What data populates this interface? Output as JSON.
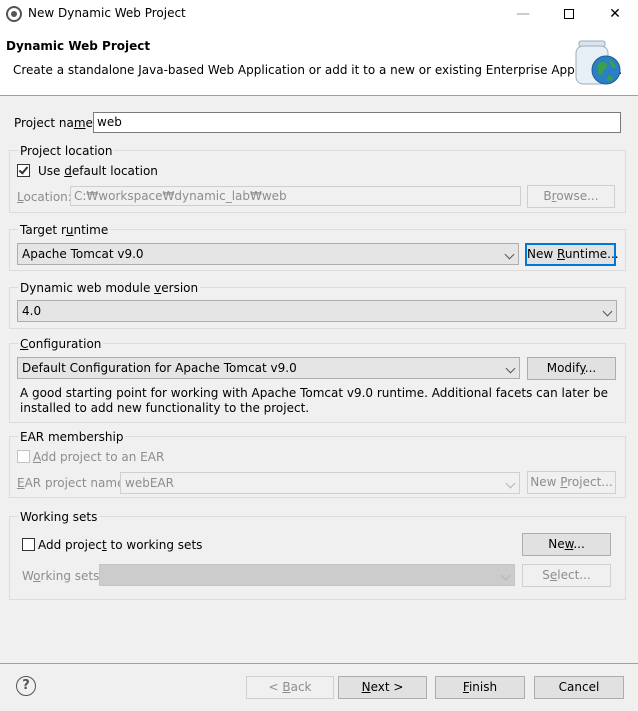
{
  "window": {
    "title": "New Dynamic Web Project",
    "minimize_glyph": "—",
    "close_glyph": "✕"
  },
  "banner": {
    "title": "Dynamic Web Project",
    "description": "Create a standalone Java-based Web Application or add it to a new or existing Enterprise Application."
  },
  "project_name": {
    "label_pre": "Project na",
    "label_u": "m",
    "label_post": "e:",
    "value": "web"
  },
  "project_location": {
    "group_label": "Project location",
    "use_default_pre": "Use ",
    "use_default_u": "d",
    "use_default_post": "efault location",
    "use_default_checked": true,
    "location_label_u": "L",
    "location_label_post": "ocation:",
    "location_value": "C:₩workspace₩dynamic_lab₩web",
    "browse_label_pre": "B",
    "browse_label_u": "r",
    "browse_label_post": "owse..."
  },
  "target_runtime": {
    "label_pre": "Target r",
    "label_u": "u",
    "label_post": "ntime",
    "value": "Apache Tomcat v9.0",
    "new_runtime_pre": "New ",
    "new_runtime_u": "R",
    "new_runtime_post": "untime..."
  },
  "module_version": {
    "label_pre": "Dynamic web module ",
    "label_u": "v",
    "label_post": "ersion",
    "value": "4.0"
  },
  "configuration": {
    "label_u": "C",
    "label_post": "onfiguration",
    "value": "Default Configuration for Apache Tomcat v9.0",
    "modify_pre": "Modif",
    "modify_u": "y",
    "modify_post": "...",
    "description": "A good starting point for working with Apache Tomcat v9.0 runtime. Additional facets can later be installed to add new functionality to the project."
  },
  "ear": {
    "group_label": "EAR membership",
    "add_label_u": "A",
    "add_label_post": "dd project to an EAR",
    "add_checked": false,
    "name_label_u": "E",
    "name_label_post": "AR project name:",
    "name_value": "webEAR",
    "new_project_pre": "New ",
    "new_project_u": "P",
    "new_project_post": "roject..."
  },
  "working_sets": {
    "group_label": "Working sets",
    "add_label_pre": "Add projec",
    "add_label_u": "t",
    "add_label_post": " to working sets",
    "add_checked": false,
    "new_pre": "Ne",
    "new_u": "w",
    "new_post": "...",
    "sets_label_pre": "W",
    "sets_label_u": "o",
    "sets_label_post": "rking sets:",
    "sets_value": "",
    "select_pre": "S",
    "select_u": "e",
    "select_post": "lect..."
  },
  "footer": {
    "help_glyph": "?",
    "back_pre": "< ",
    "back_u": "B",
    "back_post": "ack",
    "next_u": "N",
    "next_post": "ext >",
    "finish_u": "F",
    "finish_post": "inish",
    "cancel": "Cancel"
  },
  "colors": {
    "focus_border": "#0078d7",
    "disabled_text": "#8d8d8d",
    "globe_blue": "#2b7fc4",
    "globe_green": "#3aa050"
  }
}
